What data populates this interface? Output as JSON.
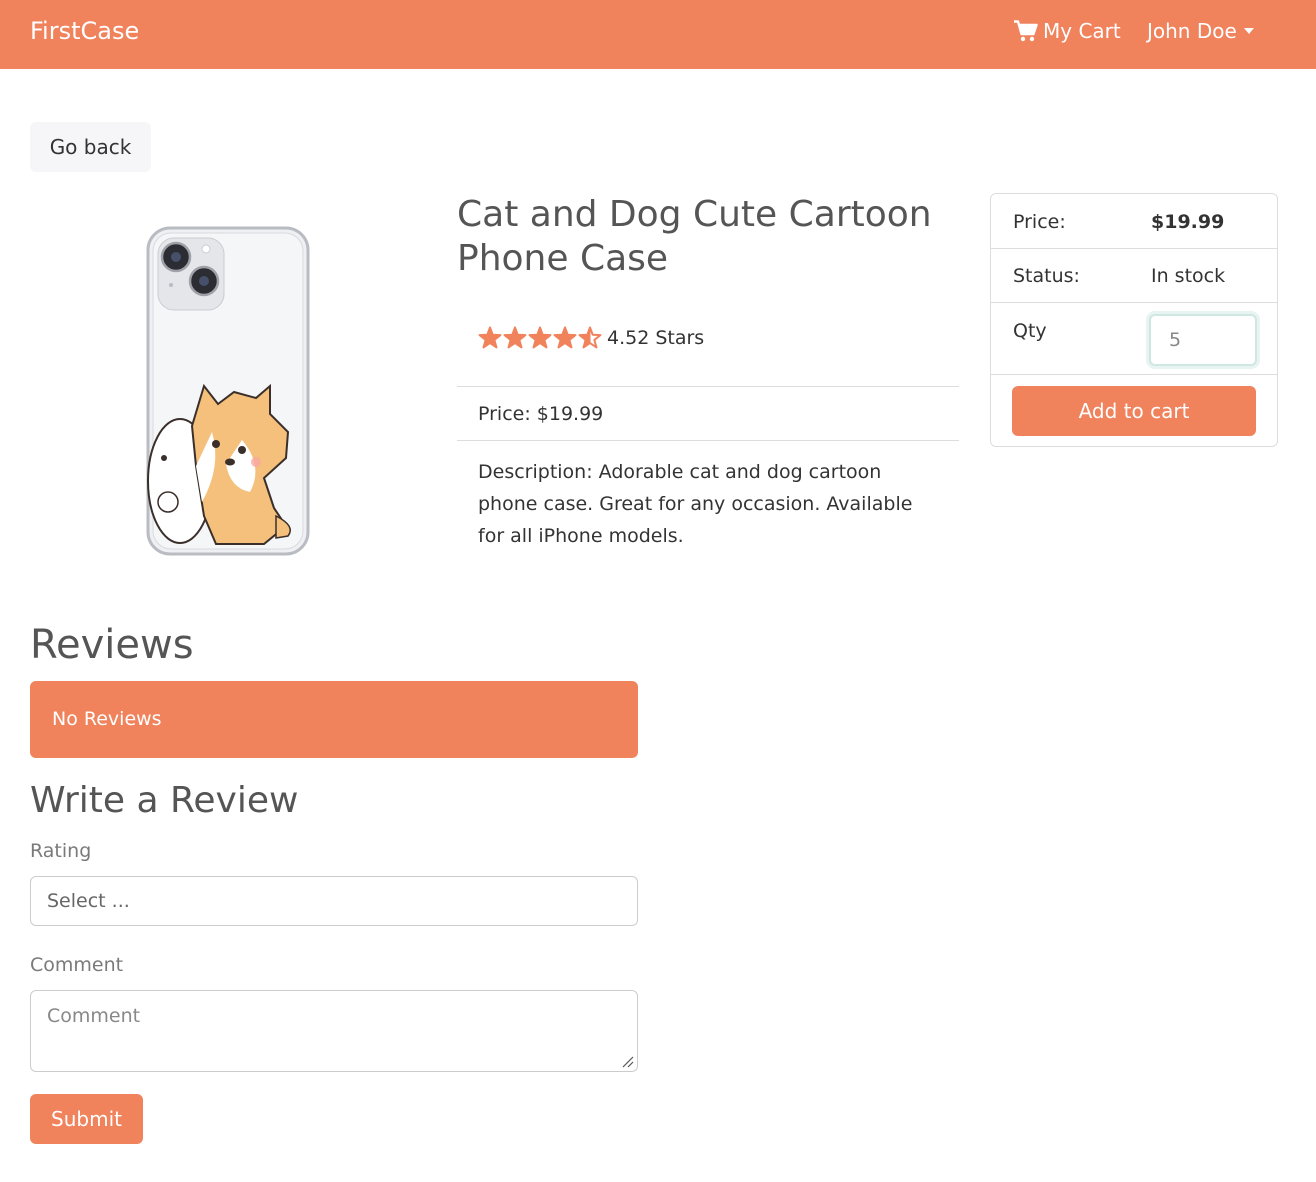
{
  "navbar": {
    "brand": "FirstCase",
    "cart_label": "My Cart",
    "cart_icon": "shopping-cart-icon",
    "user_label": "John Doe",
    "background": "#f0825c"
  },
  "go_back": "Go back",
  "product": {
    "title": "Cat and Dog Cute Cartoon Phone Case",
    "rating": 4.52,
    "rating_text": "4.52 Stars",
    "price_line": "Price: $19.99",
    "description": "Description: Adorable cat and dog cartoon phone case. Great for any occasion. Available for all iPhone models.",
    "star_color": "#f0825c"
  },
  "side": {
    "price_label": "Price:",
    "price_value": "$19.99",
    "status_label": "Status:",
    "status_value": "In stock",
    "qty_label": "Qty",
    "qty_value": "5",
    "add_to_cart": "Add to cart"
  },
  "reviews": {
    "heading": "Reviews",
    "empty_message": "No Reviews",
    "write_heading": "Write a Review",
    "rating_label": "Rating",
    "rating_select": "Select ...",
    "comment_label": "Comment",
    "comment_placeholder": "Comment",
    "submit": "Submit"
  }
}
